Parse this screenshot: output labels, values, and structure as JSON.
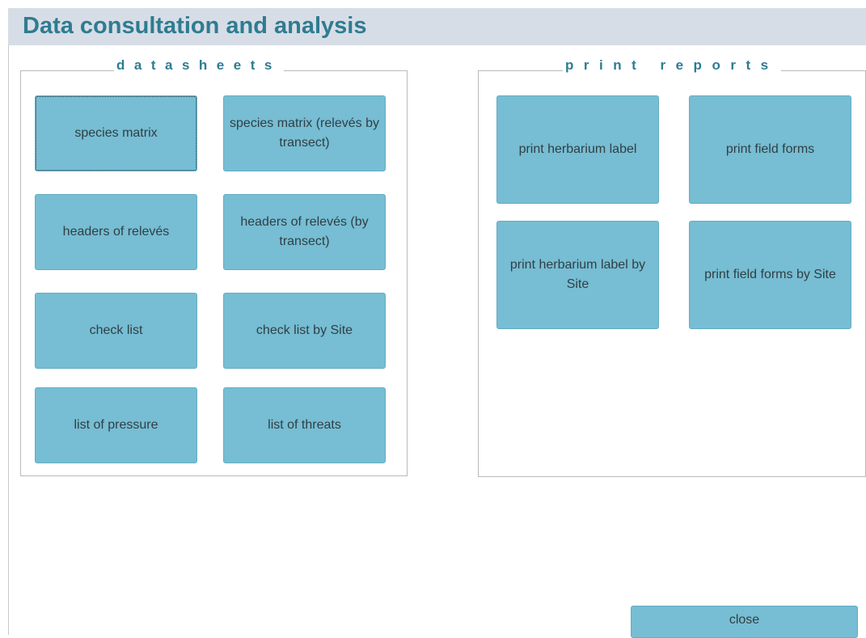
{
  "header": {
    "title": "Data consultation and analysis"
  },
  "datasheets": {
    "legend": "datasheets",
    "buttons": [
      "species matrix",
      "species matrix (relevés by transect)",
      "headers of relevés",
      "headers of relevés (by transect)",
      "check list",
      "check list by Site",
      "list of pressure",
      "list of threats"
    ]
  },
  "print_reports": {
    "legend": "print reports",
    "buttons": [
      "print herbarium label",
      "print field forms",
      "print herbarium label by Site",
      "print field forms by Site"
    ]
  },
  "footer": {
    "close_label": "close"
  },
  "colors": {
    "accent": "#2e7c91",
    "button_fill": "#77bdd3",
    "header_bar": "#d7dde6"
  }
}
